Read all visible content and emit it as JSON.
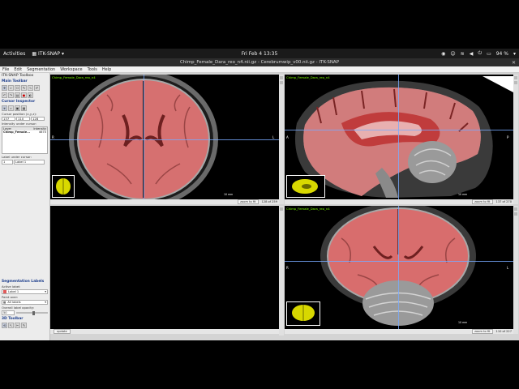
{
  "topbar": {
    "activities": "Activities",
    "app_name": "ITK-SNAP",
    "clock": "Fri Feb 4  13:35",
    "battery": "94 %"
  },
  "window": {
    "title": "Chimp_Female_Dara_reo_n4.nii.gz - Cerebrumwip_v00.nii.gz - ITK-SNAP",
    "close": "✕"
  },
  "menu": [
    "File",
    "Edit",
    "Segmentation",
    "Workspace",
    "Tools",
    "Help"
  ],
  "toolbox": {
    "header": "ITK-SNAP Toolbox",
    "main_toolbar": "Main Toolbar",
    "cursor_inspector": "Cursor Inspector",
    "cursor_position_label": "Cursor position (x,y,z):",
    "cursor_x": "137",
    "cursor_y": "110",
    "cursor_z": "128",
    "intensity_label": "Intensity under cursor:",
    "intensity_head_layer": "Layer",
    "intensity_head_value": "Intensity",
    "intensity_layer": "Chimp_Female...",
    "intensity_value": "4670",
    "label_under_cursor_label": "Label under cursor:",
    "label_under_cursor_id": "1",
    "label_under_cursor_name": "Label 1",
    "seg_labels": "Segmentation Labels",
    "active_label_label": "Active label:",
    "active_label": "Label 1",
    "paint_over_label": "Paint over:",
    "paint_over": "All labels",
    "opacity_label": "Overall label opacity:",
    "opacity_value": "50",
    "toolbar_3d": "3D Toolbar"
  },
  "views": {
    "axial": {
      "label": "Chimp_Female_Dara_reo_n4",
      "footer_zoom": "zoom to fit",
      "footer_slice": "128 of 259",
      "left": "R",
      "right": "L",
      "scale": "10 mm"
    },
    "sagittal": {
      "label": "Chimp_Female_Dara_reo_n4",
      "footer_zoom": "zoom to fit",
      "footer_slice": "137 of 270",
      "left": "A",
      "right": "P",
      "scale": "10 mm"
    },
    "coronal": {
      "label": "Chimp_Female_Dara_reo_n4",
      "footer_zoom": "zoom to fit",
      "footer_slice": "110 of 227",
      "left": "R",
      "right": "L",
      "scale": "10 mm"
    },
    "update_button": "update"
  },
  "colors": {
    "label1": "#e05a5a",
    "overlay": "rgba(232,90,90,0.72)",
    "accent_section": "#1d3e8c"
  }
}
